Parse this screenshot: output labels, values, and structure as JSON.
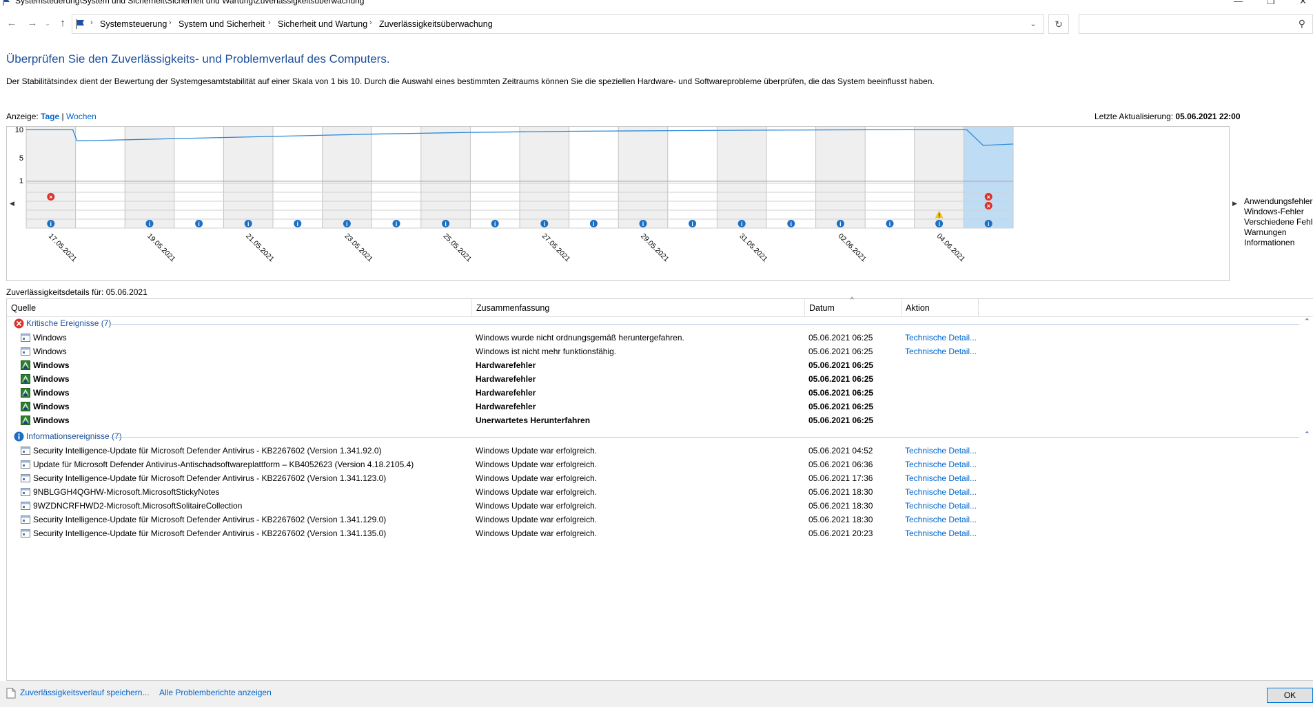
{
  "window": {
    "title": "Systemsteuerung\\System und Sicherheit\\Sicherheit und Wartung\\Zuverlässigkeitsüberwachung"
  },
  "breadcrumbs": [
    "Systemsteuerung",
    "System und Sicherheit",
    "Sicherheit und Wartung",
    "Zuverlässigkeitsüberwachung"
  ],
  "search": {
    "placeholder": ""
  },
  "heading": "Überprüfen Sie den Zuverlässigkeits- und Problemverlauf des Computers.",
  "description": "Der Stabilitätsindex dient der Bewertung der Systemgesamtstabilität auf einer Skala von 1 bis 10. Durch die Auswahl eines bestimmten Zeitraums können Sie die speziellen Hardware- und Softwareprobleme überprüfen, die das System beeinflusst haben.",
  "view": {
    "label": "Anzeige:",
    "days": "Tage",
    "sep": "|",
    "weeks": "Wochen"
  },
  "last_update": {
    "label": "Letzte Aktualisierung:",
    "value": "05.06.2021 22:00"
  },
  "chart_data": {
    "type": "line",
    "title": "",
    "y_ticks": [
      "10",
      "5",
      "1"
    ],
    "ylim": [
      1,
      10
    ],
    "categories": [
      "17.05.2021",
      "18.05.2021",
      "19.05.2021",
      "20.05.2021",
      "21.05.2021",
      "22.05.2021",
      "23.05.2021",
      "24.05.2021",
      "25.05.2021",
      "26.05.2021",
      "27.05.2021",
      "28.05.2021",
      "29.05.2021",
      "30.05.2021",
      "31.05.2021",
      "01.06.2021",
      "02.06.2021",
      "03.06.2021",
      "04.06.2021",
      "05.06.2021"
    ],
    "date_labels": [
      "17.05.2021",
      "19.05.2021",
      "21.05.2021",
      "23.05.2021",
      "25.05.2021",
      "27.05.2021",
      "29.05.2021",
      "31.05.2021",
      "02.06.2021",
      "04.06.2021"
    ],
    "series": [
      {
        "values": [
          10,
          8.0,
          8.2,
          8.4,
          8.6,
          8.8,
          9.0,
          9.2,
          9.35,
          9.5,
          9.6,
          9.7,
          9.75,
          9.8,
          9.85,
          9.9,
          9.93,
          9.96,
          10,
          7.2
        ]
      }
    ],
    "event_rows": [
      "Anwendungsfehler",
      "Windows-Fehler",
      "Verschiedene Fehler",
      "Warnungen",
      "Informationen"
    ],
    "events": {
      "windows_errors": [
        "17.05.2021",
        "05.06.2021"
      ],
      "misc_errors": [
        "05.06.2021"
      ],
      "warnings": [
        "04.06.2021"
      ],
      "information": [
        "17.05.2021",
        "19.05.2021",
        "20.05.2021",
        "21.05.2021",
        "22.05.2021",
        "23.05.2021",
        "24.05.2021",
        "25.05.2021",
        "26.05.2021",
        "27.05.2021",
        "28.05.2021",
        "29.05.2021",
        "30.05.2021",
        "31.05.2021",
        "01.06.2021",
        "02.06.2021",
        "03.06.2021",
        "04.06.2021",
        "05.06.2021"
      ]
    },
    "selected": "05.06.2021",
    "colors": {
      "line": "#2b88d8",
      "selected": "#bfdcf5",
      "shaded": "#efefef",
      "error": "#d9342b",
      "info": "#1c6fc2",
      "warning": "#f2c318"
    }
  },
  "legend": [
    "Anwendungsfehler",
    "Windows-Fehler",
    "Verschiedene Fehle",
    "Warnungen",
    "Informationen"
  ],
  "details": {
    "label": "Zuverlässigkeitsdetails für: 05.06.2021",
    "columns": [
      "Quelle",
      "Zusammenfassung",
      "Datum",
      "Aktion"
    ],
    "groups": [
      {
        "label": "Kritische Ereignisse (7)",
        "icon": "error-icon",
        "rows": [
          {
            "source": "Windows",
            "summary": "Windows wurde nicht ordnungsgemäß heruntergefahren.",
            "date": "05.06.2021 06:25",
            "action": "Technische Detail...",
            "bold": false,
            "icon": "app-window-icon"
          },
          {
            "source": "Windows",
            "summary": "Windows ist nicht mehr funktionsfähig.",
            "date": "05.06.2021 06:25",
            "action": "Technische Detail...",
            "bold": false,
            "icon": "app-window-icon"
          },
          {
            "source": "Windows",
            "summary": "Hardwarefehler",
            "date": "05.06.2021 06:25",
            "action": "",
            "bold": true,
            "icon": "hardware-icon"
          },
          {
            "source": "Windows",
            "summary": "Hardwarefehler",
            "date": "05.06.2021 06:25",
            "action": "",
            "bold": true,
            "icon": "hardware-icon"
          },
          {
            "source": "Windows",
            "summary": "Hardwarefehler",
            "date": "05.06.2021 06:25",
            "action": "",
            "bold": true,
            "icon": "hardware-icon"
          },
          {
            "source": "Windows",
            "summary": "Hardwarefehler",
            "date": "05.06.2021 06:25",
            "action": "",
            "bold": true,
            "icon": "hardware-icon"
          },
          {
            "source": "Windows",
            "summary": "Unerwartetes Herunterfahren",
            "date": "05.06.2021 06:25",
            "action": "",
            "bold": true,
            "icon": "hardware-icon"
          }
        ]
      },
      {
        "label": "Informationsereignisse (7)",
        "icon": "info-icon",
        "rows": [
          {
            "source": "Security Intelligence-Update für Microsoft Defender Antivirus - KB2267602 (Version 1.341.92.0)",
            "summary": "Windows Update war erfolgreich.",
            "date": "05.06.2021 04:52",
            "action": "Technische Detail...",
            "bold": false,
            "icon": "app-window-icon"
          },
          {
            "source": "Update für Microsoft Defender Antivirus-Antischadsoftwareplattform – KB4052623 (Version 4.18.2105.4)",
            "summary": "Windows Update war erfolgreich.",
            "date": "05.06.2021 06:36",
            "action": "Technische Detail...",
            "bold": false,
            "icon": "app-window-icon"
          },
          {
            "source": "Security Intelligence-Update für Microsoft Defender Antivirus - KB2267602 (Version 1.341.123.0)",
            "summary": "Windows Update war erfolgreich.",
            "date": "05.06.2021 17:36",
            "action": "Technische Detail...",
            "bold": false,
            "icon": "app-window-icon"
          },
          {
            "source": "9NBLGGH4QGHW-Microsoft.MicrosoftStickyNotes",
            "summary": "Windows Update war erfolgreich.",
            "date": "05.06.2021 18:30",
            "action": "Technische Detail...",
            "bold": false,
            "icon": "app-window-icon"
          },
          {
            "source": "9WZDNCRFHWD2-Microsoft.MicrosoftSolitaireCollection",
            "summary": "Windows Update war erfolgreich.",
            "date": "05.06.2021 18:30",
            "action": "Technische Detail...",
            "bold": false,
            "icon": "app-window-icon"
          },
          {
            "source": "Security Intelligence-Update für Microsoft Defender Antivirus - KB2267602 (Version 1.341.129.0)",
            "summary": "Windows Update war erfolgreich.",
            "date": "05.06.2021 18:30",
            "action": "Technische Detail...",
            "bold": false,
            "icon": "app-window-icon"
          },
          {
            "source": "Security Intelligence-Update für Microsoft Defender Antivirus - KB2267602 (Version 1.341.135.0)",
            "summary": "Windows Update war erfolgreich.",
            "date": "05.06.2021 20:23",
            "action": "Technische Detail...",
            "bold": false,
            "icon": "app-window-icon"
          }
        ]
      }
    ]
  },
  "footer": {
    "save_link": "Zuverlässigkeitsverlauf speichern...",
    "reports_link": "Alle Problemberichte anzeigen",
    "ok_label": "OK"
  }
}
